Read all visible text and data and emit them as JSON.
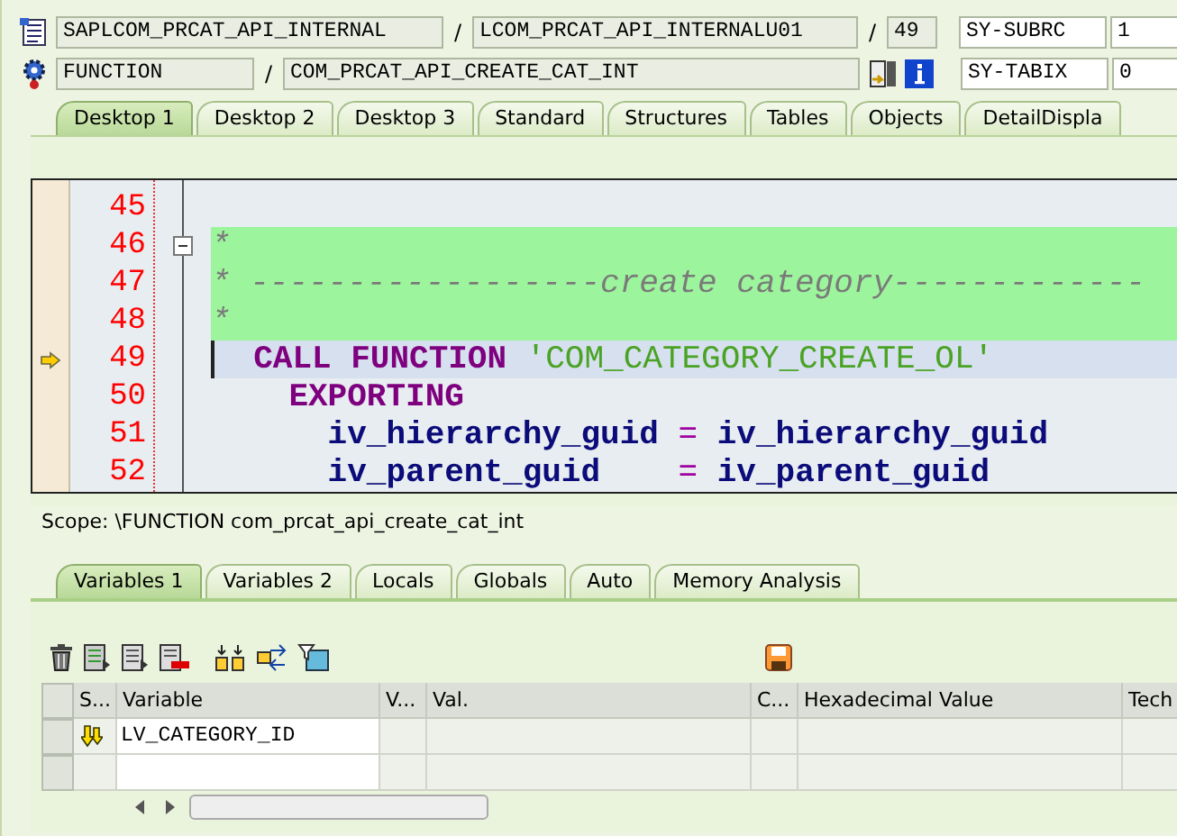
{
  "header": {
    "row1": {
      "program": "SAPLCOM_PRCAT_API_INTERNAL",
      "include": "LCOM_PRCAT_API_INTERNALU01",
      "line": "49",
      "sy_label": "SY-SUBRC",
      "sy_value": "1"
    },
    "row2": {
      "event_type": "FUNCTION",
      "event": "COM_PRCAT_API_CREATE_CAT_INT",
      "sy_label": "SY-TABIX",
      "sy_value": "0"
    }
  },
  "separator": "/",
  "desktop_tabs": [
    {
      "label": "Desktop 1",
      "selected": true
    },
    {
      "label": "Desktop 2",
      "selected": false
    },
    {
      "label": "Desktop 3",
      "selected": false
    },
    {
      "label": "Standard",
      "selected": false
    },
    {
      "label": "Structures",
      "selected": false
    },
    {
      "label": "Tables",
      "selected": false
    },
    {
      "label": "Objects",
      "selected": false
    },
    {
      "label": "DetailDispla",
      "selected": false
    }
  ],
  "code_lines": [
    {
      "number": "45",
      "kind": "code",
      "current": false,
      "foldable": false
    },
    {
      "number": "46",
      "kind": "comment",
      "current": false,
      "foldable": true,
      "tokens": [
        {
          "text": "*",
          "kind": "comment"
        }
      ]
    },
    {
      "number": "47",
      "kind": "comment",
      "current": false,
      "foldable": false,
      "tokens": [
        {
          "text": "* ------------------create category-------------",
          "kind": "comment"
        }
      ]
    },
    {
      "number": "48",
      "kind": "comment",
      "current": false,
      "foldable": false,
      "tokens": [
        {
          "text": "*",
          "kind": "comment"
        }
      ]
    },
    {
      "number": "49",
      "kind": "code",
      "current": true,
      "foldable": false,
      "tokens": [
        {
          "text": "  CALL FUNCTION ",
          "kind": "keyword"
        },
        {
          "text": "'COM_CATEGORY_CREATE_OL'",
          "kind": "string"
        }
      ]
    },
    {
      "number": "50",
      "kind": "code",
      "current": false,
      "foldable": false,
      "tokens": [
        {
          "text": "    EXPORTING",
          "kind": "keyword"
        }
      ]
    },
    {
      "number": "51",
      "kind": "code",
      "current": false,
      "foldable": false,
      "tokens": [
        {
          "text": "      iv_hierarchy_guid ",
          "kind": "ident"
        },
        {
          "text": "=",
          "kind": "operator"
        },
        {
          "text": " iv_hierarchy_guid",
          "kind": "ident"
        }
      ]
    },
    {
      "number": "52",
      "kind": "code",
      "current": false,
      "foldable": false,
      "tokens": [
        {
          "text": "      iv_parent_guid    ",
          "kind": "ident"
        },
        {
          "text": "=",
          "kind": "operator"
        },
        {
          "text": " iv_parent_guid",
          "kind": "ident"
        }
      ]
    }
  ],
  "scope": "Scope: \\FUNCTION com_prcat_api_create_cat_int",
  "variable_tabs": [
    {
      "label": "Variables 1",
      "selected": true
    },
    {
      "label": "Variables 2",
      "selected": false
    },
    {
      "label": "Locals",
      "selected": false
    },
    {
      "label": "Globals",
      "selected": false
    },
    {
      "label": "Auto",
      "selected": false
    },
    {
      "label": "Memory Analysis",
      "selected": false
    }
  ],
  "table": {
    "columns": [
      "S...",
      "Variable",
      "V...",
      "Val.",
      "C...",
      "Hexadecimal Value",
      "Tech"
    ],
    "rows": [
      {
        "variable": "LV_CATEGORY_ID",
        "has_icon": true
      },
      {
        "has_icon": false
      }
    ]
  }
}
